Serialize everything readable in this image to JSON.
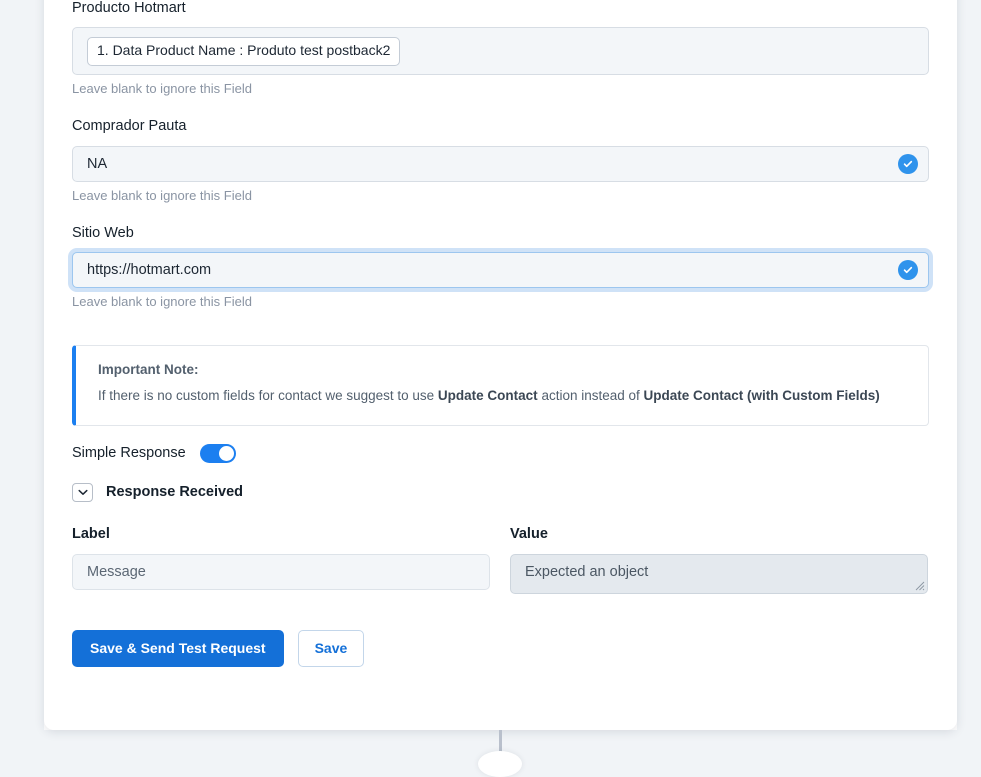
{
  "colors": {
    "accent_blue": "#1470d8",
    "toggle_on": "#1c7ff0",
    "check_badge": "#2f93ec",
    "note_border": "#1c7ff0",
    "input_bg": "#f3f6f9",
    "page_bg": "#f1f4f7"
  },
  "fields": [
    {
      "label": "Producto Hotmart",
      "type": "token",
      "token_value": "1. Data Product Name : Produto test postback2",
      "hint": "Leave blank to ignore this Field",
      "has_check": false,
      "focused": false
    },
    {
      "label": "Comprador Pauta",
      "type": "text",
      "value": "NA",
      "hint": "Leave blank to ignore this Field",
      "has_check": true,
      "focused": false
    },
    {
      "label": "Sitio Web",
      "type": "text",
      "value": "https://hotmart.com",
      "hint": "Leave blank to ignore this Field",
      "has_check": true,
      "focused": true
    }
  ],
  "note": {
    "title": "Important Note:",
    "text_part_1": "If there is no custom fields for contact we suggest to use ",
    "bold_1": "Update Contact",
    "text_part_2": " action instead of ",
    "bold_2": "Update Contact (with Custom Fields)"
  },
  "simple_response": {
    "label": "Simple Response",
    "state": "on"
  },
  "response_section": {
    "title": "Response Received",
    "chevron": "chevron-down-icon",
    "columns": {
      "label_header": "Label",
      "value_header": "Value"
    },
    "rows": [
      {
        "label": "Message",
        "value": "Expected an object"
      }
    ]
  },
  "buttons": {
    "primary": "Save & Send Test Request",
    "secondary": "Save"
  }
}
